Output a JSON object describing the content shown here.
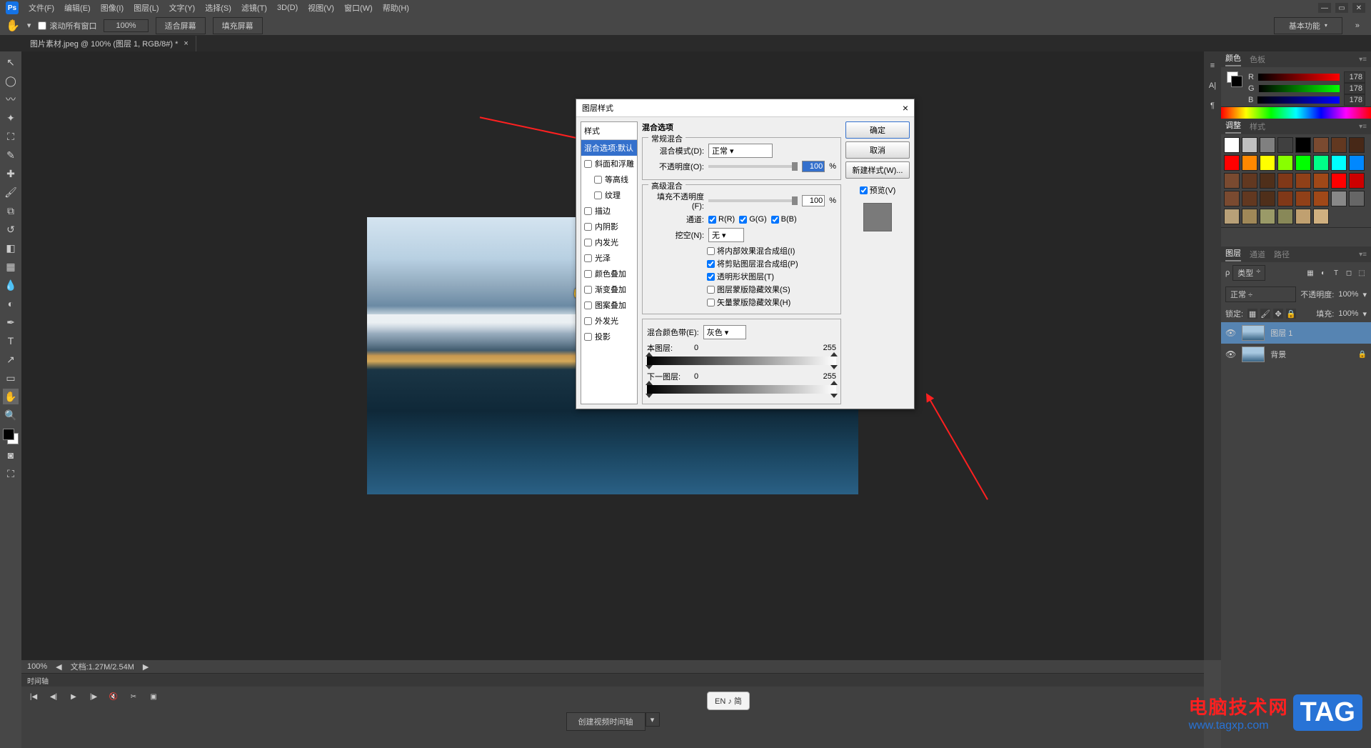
{
  "menubar": [
    "文件(F)",
    "编辑(E)",
    "图像(I)",
    "图层(L)",
    "文字(Y)",
    "选择(S)",
    "滤镜(T)",
    "3D(D)",
    "视图(V)",
    "窗口(W)",
    "帮助(H)"
  ],
  "options": {
    "scroll_all": "滚动所有窗口",
    "zoom": "100%",
    "fit": "适合屏幕",
    "fill": "填充屏幕",
    "basic": "基本功能"
  },
  "doc_tab": "图片素材.jpeg @ 100% (图层 1, RGB/8#) *",
  "status": {
    "zoom": "100%",
    "doc": "文档:1.27M/2.54M"
  },
  "timeline": {
    "title": "时间轴",
    "create": "创建视频时间轴"
  },
  "ime": "EN ♪ 简",
  "color": {
    "tab1": "颜色",
    "tab2": "色板",
    "r_lbl": "R",
    "g_lbl": "G",
    "b_lbl": "B",
    "r": "178",
    "g": "178",
    "b": "178"
  },
  "adjust": {
    "tab1": "调整",
    "tab2": "样式"
  },
  "swatches": [
    "#fff",
    "#c0c0c0",
    "#808080",
    "#404040",
    "#000",
    "#7a4a30",
    "#623820",
    "#472817",
    "#f00",
    "#f80",
    "#ff0",
    "#8f0",
    "#0f0",
    "#0f8",
    "#0ff",
    "#08f",
    "#7a4a30",
    "#623820",
    "#4f2f1a",
    "#803818",
    "#904018",
    "#a04818",
    "#f00",
    "#c00",
    "#7a4a30",
    "#623820",
    "#4f2f1a",
    "#803818",
    "#904018",
    "#a04818",
    "#888",
    "#666",
    "#b8a078",
    "#a08858",
    "#9a9a68",
    "#888858",
    "#c0a070",
    "#d0b080"
  ],
  "layers": {
    "tab1": "图层",
    "tab2": "通道",
    "tab3": "路径",
    "kind": "类型",
    "blend": "正常",
    "opacity_lbl": "不透明度:",
    "opacity": "100%",
    "lock_lbl": "锁定:",
    "fill_lbl": "填充:",
    "fill": "100%",
    "layer1": "图层 1",
    "bg": "背景"
  },
  "dialog": {
    "title": "图层样式",
    "styles_hd": "样式",
    "styles": [
      "混合选项:默认",
      "斜面和浮雕",
      "等高线",
      "纹理",
      "描边",
      "内阴影",
      "内发光",
      "光泽",
      "颜色叠加",
      "渐变叠加",
      "图案叠加",
      "外发光",
      "投影"
    ],
    "blend_opts": "混合选项",
    "general": "常规混合",
    "blend_mode_lbl": "混合模式(D):",
    "blend_mode": "正常",
    "opacity_lbl": "不透明度(O):",
    "opacity": "100",
    "pct": "%",
    "advanced": "高级混合",
    "fill_opacity_lbl": "填充不透明度(F):",
    "fill_opacity": "100",
    "channels_lbl": "通道:",
    "ch_r": "R(R)",
    "ch_g": "G(G)",
    "ch_b": "B(B)",
    "knockout_lbl": "挖空(N):",
    "knockout": "无",
    "adv_cb": [
      "将内部效果混合成组(I)",
      "将剪贴图层混合成组(P)",
      "透明形状图层(T)",
      "图层蒙版隐藏效果(S)",
      "矢量蒙版隐藏效果(H)"
    ],
    "adv_checked": [
      false,
      true,
      true,
      false,
      false
    ],
    "blendif_lbl": "混合颜色带(E):",
    "blendif": "灰色 ▾",
    "this_layer": "本图层:",
    "this_lo": "0",
    "this_hi": "255",
    "under_layer": "下一图层:",
    "under_lo": "0",
    "under_hi": "255",
    "ok": "确定",
    "cancel": "取消",
    "newstyle": "新建样式(W)...",
    "preview_lbl": "预览(V)"
  },
  "watermark": {
    "line1": "电脑技术网",
    "line2": "www.tagxp.com",
    "badge": "TAG"
  }
}
